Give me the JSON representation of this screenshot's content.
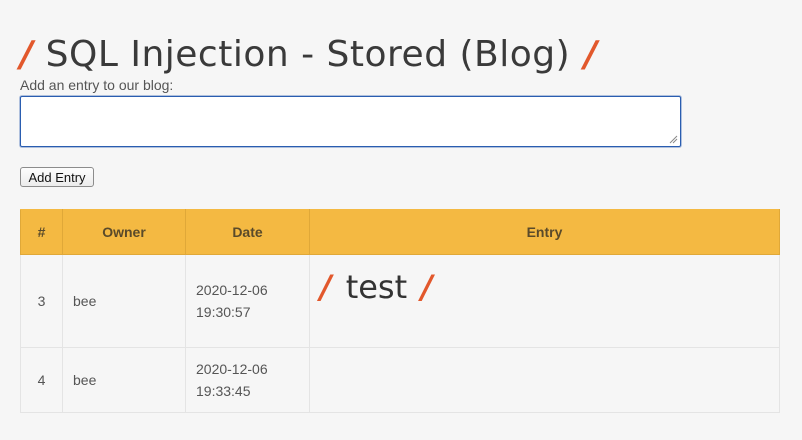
{
  "page": {
    "title": "SQL Injection - Stored (Blog)",
    "title_slash": "/"
  },
  "form": {
    "label": "Add an entry to our blog:",
    "entry_value": "",
    "submit_label": "Add Entry"
  },
  "table": {
    "headers": {
      "num": "#",
      "owner": "Owner",
      "date": "Date",
      "entry": "Entry"
    },
    "rows": [
      {
        "num": "3",
        "owner": "bee",
        "date_line1": "2020-12-06",
        "date_line2": "19:30:57",
        "entry": "test",
        "entry_slash": "/"
      },
      {
        "num": "4",
        "owner": "bee",
        "date_line1": "2020-12-06",
        "date_line2": "19:33:45",
        "entry": ""
      }
    ]
  },
  "colors": {
    "accent_slash": "#e2582c",
    "table_header_bg": "#f4b942",
    "input_focus_border": "#2a5db0",
    "page_bg": "#f6f6f6"
  }
}
